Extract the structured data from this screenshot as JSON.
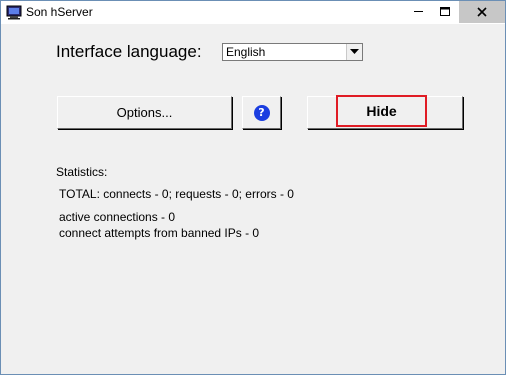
{
  "window": {
    "title": "Son hServer",
    "app_icon": "computer-monitor-icon",
    "controls": {
      "minimize": "minimize-icon",
      "maximize": "maximize-icon",
      "close": "close-icon"
    }
  },
  "language": {
    "label": "Interface language:",
    "selected": "English"
  },
  "buttons": {
    "options_label": "Options...",
    "help_icon": "help-icon",
    "help_glyph": "?",
    "hide_label": "Hide"
  },
  "statistics": {
    "heading": "Statistics:",
    "total": "TOTAL: connects - 0; requests - 0; errors - 0",
    "active": "active connections - 0",
    "banned": "connect attempts from banned IPs - 0"
  },
  "colors": {
    "focus_outline": "#e01b24",
    "help_icon_bg": "#1b3ee0",
    "window_bg": "#f0f0f0"
  }
}
